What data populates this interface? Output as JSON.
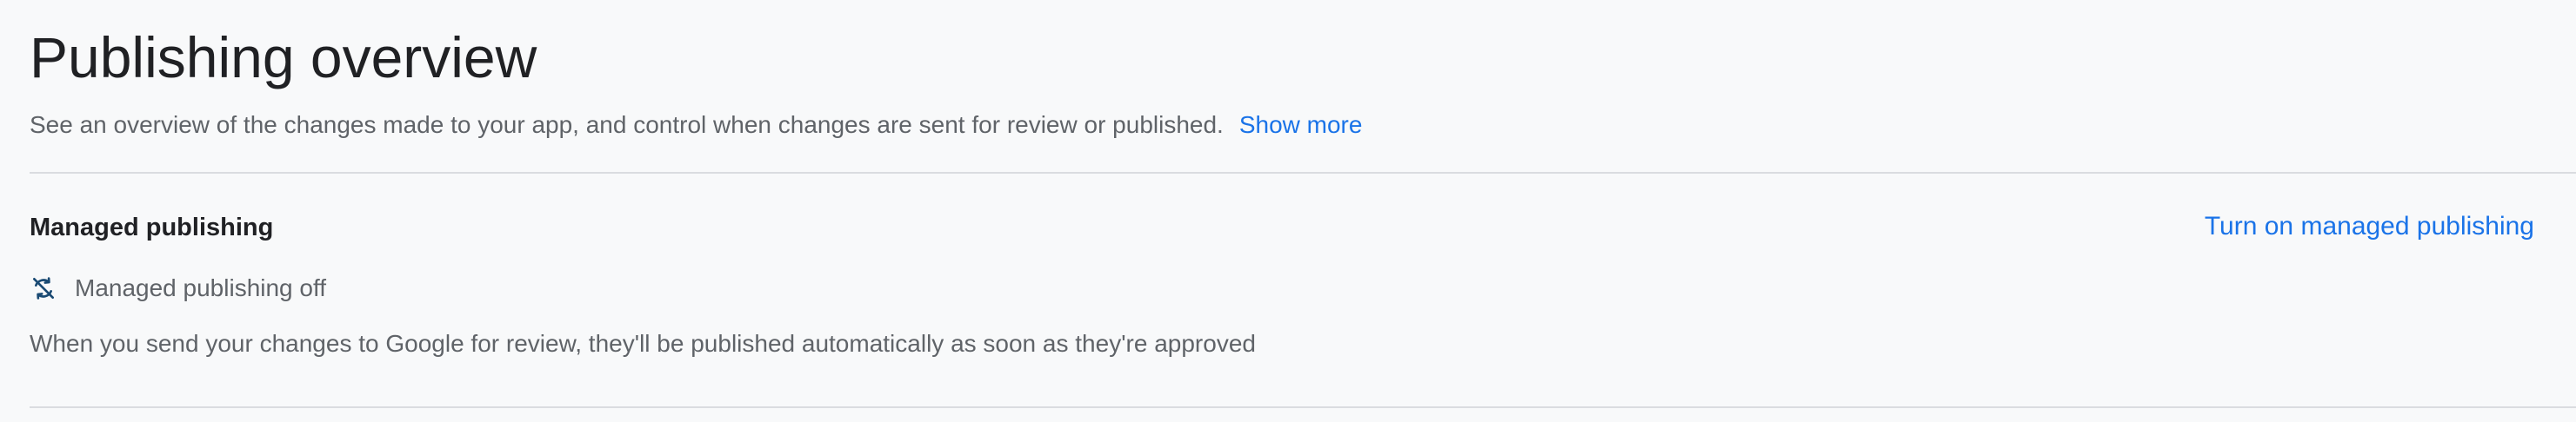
{
  "header": {
    "title": "Publishing overview",
    "subtitle": "See an overview of the changes made to your app, and control when changes are sent for review or published.",
    "show_more_label": "Show more"
  },
  "managed_publishing": {
    "section_title": "Managed publishing",
    "action_label": "Turn on managed publishing",
    "status_icon": "sync-disabled-icon",
    "status_text": "Managed publishing off",
    "description": "When you send your changes to Google for review, they'll be published automatically as soon as they're approved"
  },
  "colors": {
    "link": "#1a73e8",
    "text_primary": "#202124",
    "text_secondary": "#5f6368",
    "status_icon": "#1a4a73",
    "divider": "#dadce0",
    "background": "#f8f9fa"
  }
}
